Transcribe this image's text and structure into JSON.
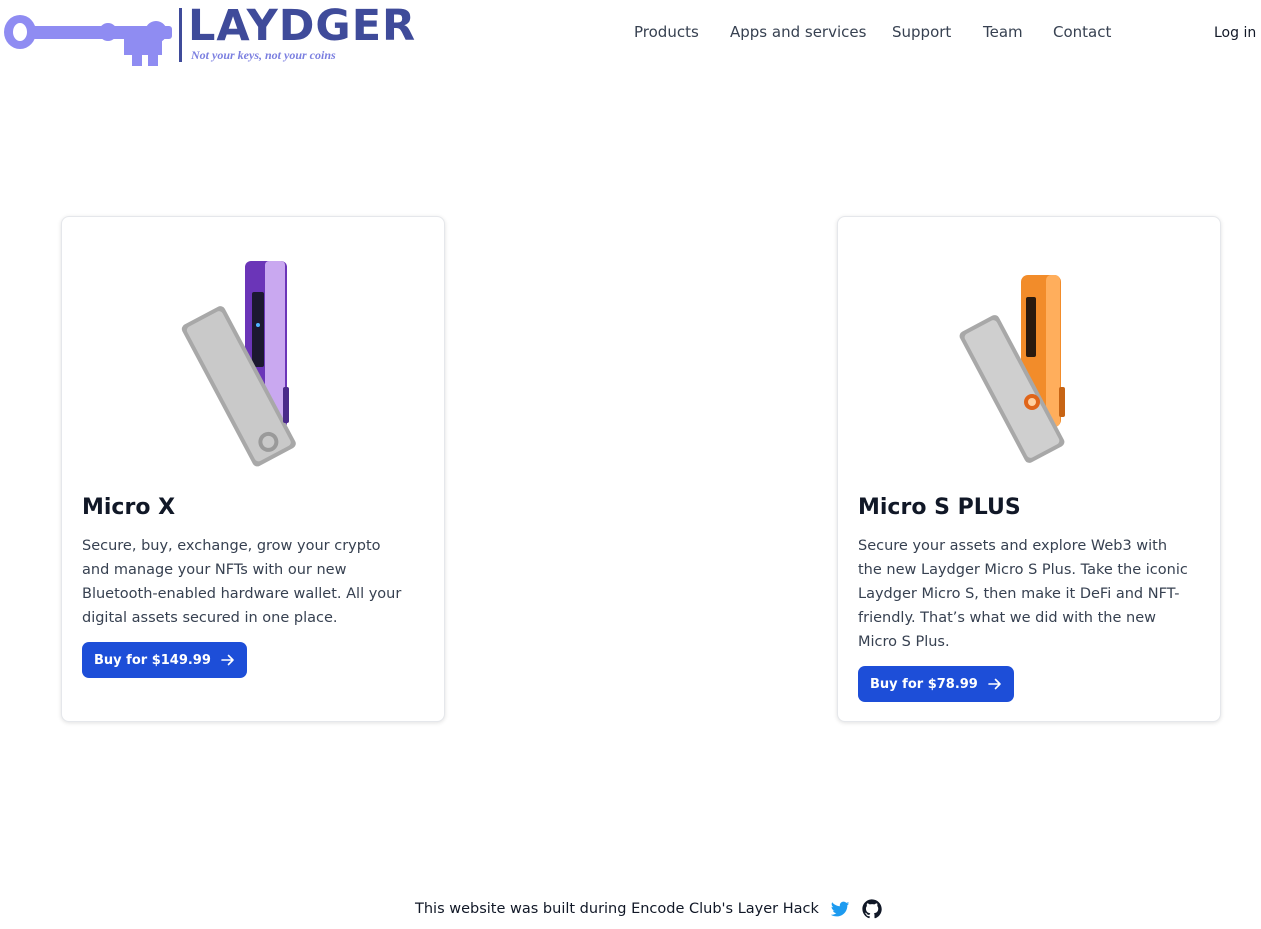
{
  "brand": {
    "name": "LAYDGER",
    "tagline": "Not your keys, not your coins",
    "key_color": "#8f8cf2",
    "text_color": "#3f4b9a"
  },
  "nav": {
    "items": [
      {
        "label": "Products"
      },
      {
        "label": "Apps and services"
      },
      {
        "label": "Support"
      },
      {
        "label": "Team"
      },
      {
        "label": "Contact"
      }
    ],
    "login_label": "Log in"
  },
  "products": [
    {
      "title": "Micro X",
      "description": "Secure, buy, exchange, grow your crypto and manage your NFTs with our new Bluetooth-enabled hardware wallet. All your digital assets secured in one place.",
      "button_label": "Buy for $149.99",
      "accent_color": "#6b35b8"
    },
    {
      "title": "Micro S PLUS",
      "description": "Secure your assets and explore Web3 with the new Laydger Micro S Plus. Take the iconic Laydger Micro S, then make it DeFi and NFT-friendly. That’s what we did with the new Micro S Plus.",
      "button_label": "Buy for $78.99",
      "accent_color": "#f28c2a"
    }
  ],
  "footer": {
    "text": "This website was built during Encode Club's Layer Hack",
    "icons": [
      "twitter-icon",
      "github-icon"
    ]
  },
  "colors": {
    "button": "#1d4ed8",
    "twitter": "#1d9bf0"
  }
}
